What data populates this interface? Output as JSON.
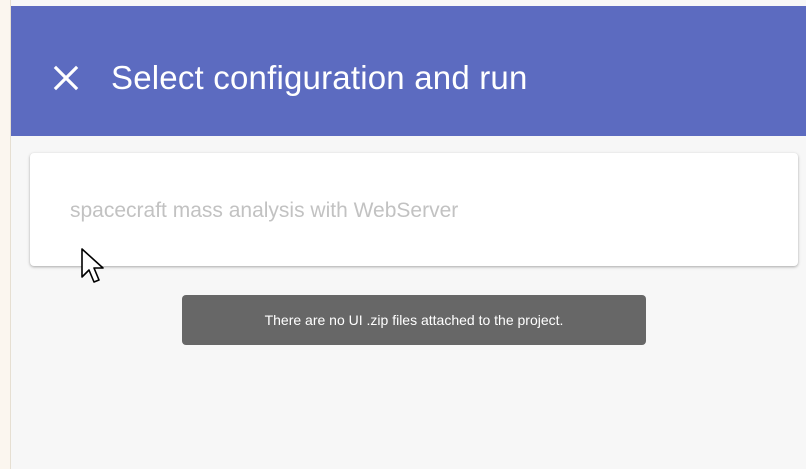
{
  "dialog": {
    "title": "Select configuration and run",
    "close_icon": "close-icon"
  },
  "configuration": {
    "placeholder": "spacecraft mass analysis with WebServer",
    "value": ""
  },
  "tooltip": {
    "text": "There are no UI .zip files attached to the project."
  },
  "colors": {
    "header": "#5c6bc0",
    "background": "#f7f7f7",
    "card": "#ffffff",
    "tooltip": "#676767"
  }
}
